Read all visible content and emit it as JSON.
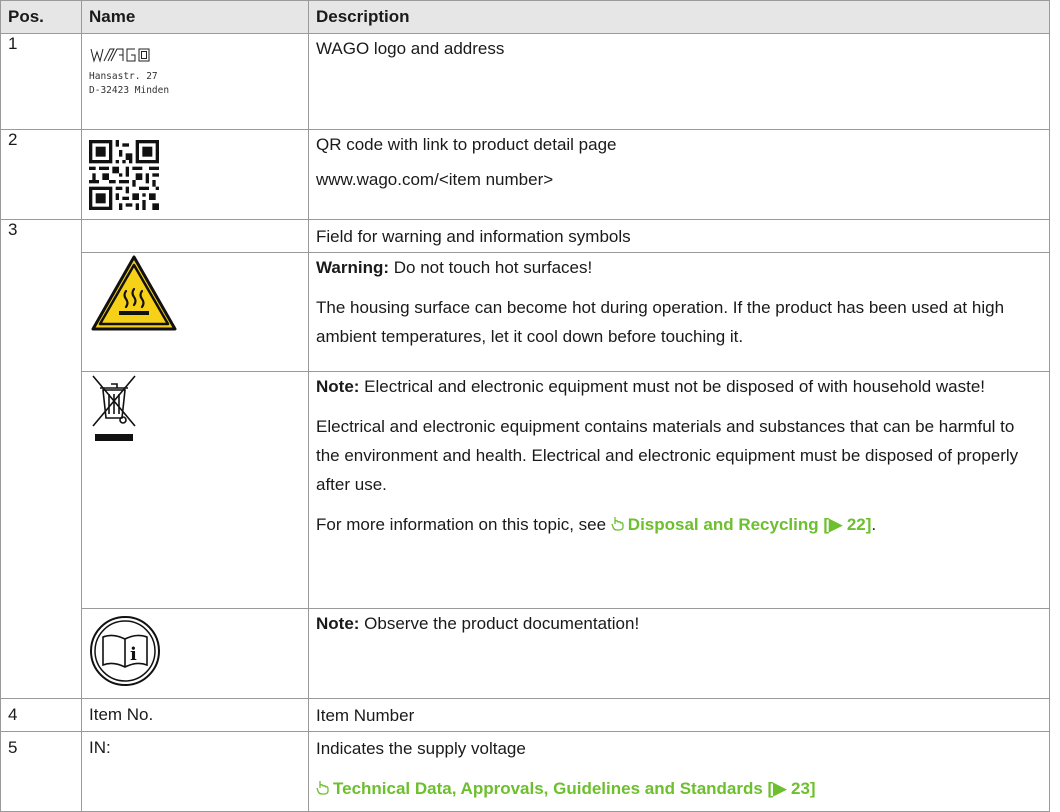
{
  "table": {
    "headers": {
      "pos": "Pos.",
      "name": "Name",
      "description": "Description"
    },
    "row1": {
      "pos": "1",
      "logo_text": "WAGO",
      "address_line1": "Hansastr. 27",
      "address_line2": "D-32423 Minden",
      "description": "WAGO logo and address"
    },
    "row2": {
      "pos": "2",
      "description": "QR code with link to product detail page",
      "url": "www.wago.com/<item number>"
    },
    "row3": {
      "pos": "3",
      "description": "Field for warning and information symbols",
      "warning_label": "Warning:",
      "warning_text": " Do not touch hot surfaces!",
      "warning_detail": "The housing surface can become hot during operation. If the product has been used at high ambient temperatures, let it cool down before touching it.",
      "note1_label": "Note:",
      "note1_text": " Electrical and electronic equipment must not be disposed of with household waste!",
      "note1_detail": "Electrical and electronic equipment contains materials and substances that can be harmful to the environment and health. Electrical and electronic equipment must be disposed of properly after use.",
      "note1_more_prefix": "For more information on this topic, see ",
      "note1_link": "Disposal and Recycling [▶ 22]",
      "note1_more_suffix": ".",
      "note2_label": "Note:",
      "note2_text": " Observe the product documentation!"
    },
    "row4": {
      "pos": "4",
      "name": "Item No.",
      "description": "Item Number"
    },
    "row5": {
      "pos": "5",
      "name": "IN:",
      "description": "Indicates the supply voltage",
      "link": "Technical Data, Approvals, Guidelines and Standards [▶ 23]"
    }
  },
  "icons": {
    "logo": "wago-logo",
    "qr": "qr-code-icon",
    "hot_surface": "hot-surface-warning-icon",
    "weee": "crossed-out-wheelie-bin-icon",
    "manual": "read-manual-icon",
    "link_pointer": "hand-pointer-icon"
  },
  "colors": {
    "link": "#6cbf2d",
    "warning_yellow": "#f7d117",
    "header_bg": "#e6e6e6"
  }
}
